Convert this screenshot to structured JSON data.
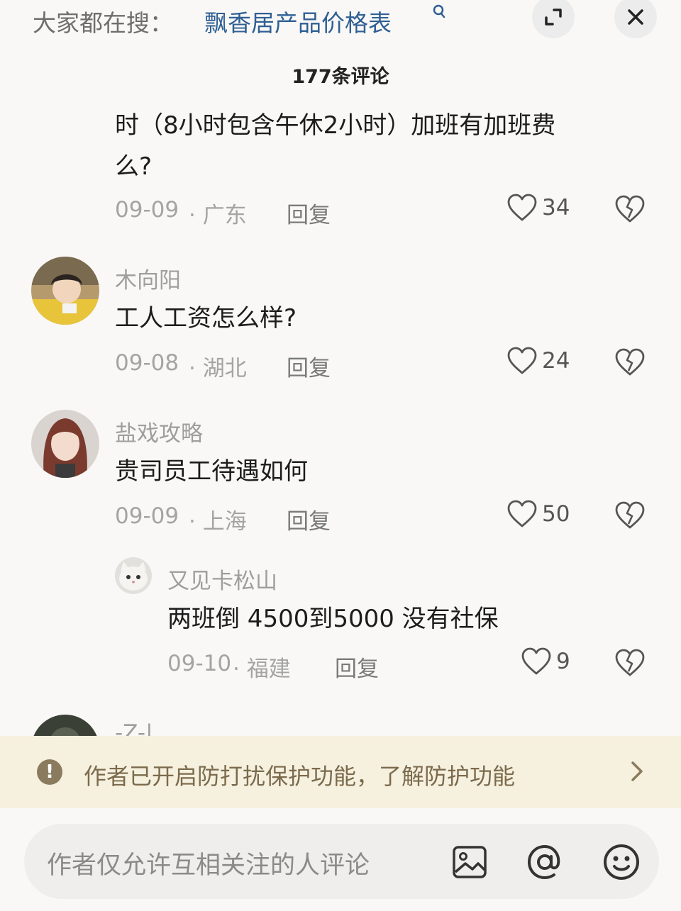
{
  "header": {
    "search_hint": "大家都在搜：",
    "search_link": "飘香居产品价格表"
  },
  "comment_count": "177条评论",
  "comments": [
    {
      "text_line1": "时（8小时包含午休2小时）加班有加班费",
      "text_line2": "么?",
      "date": "09-09",
      "location": "· 广东",
      "reply": "回复",
      "likes": "34"
    },
    {
      "username": "木向阳",
      "text": "工人工资怎么样?",
      "date": "09-08",
      "location": "· 湖北",
      "reply": "回复",
      "likes": "24"
    },
    {
      "username": "盐戏攻略",
      "text": "贵司员工待遇如何",
      "date": "09-09",
      "location": "· 上海",
      "reply": "回复",
      "likes": "50"
    },
    {
      "username": "又见卡松山",
      "text": "两班倒 4500到5000 没有社保",
      "date": "09-10",
      "location": "· 福建",
      "reply": "回复",
      "likes": "9"
    },
    {
      "username": "-Z-|"
    }
  ],
  "notice": {
    "text": "作者已开启防打扰保护功能，了解防护功能"
  },
  "input": {
    "placeholder": "作者仅允许互相关注的人评论"
  },
  "colors": {
    "link": "#2f5f94",
    "notice_bg": "#f6f0df",
    "notice_text": "#7b6b4c"
  }
}
